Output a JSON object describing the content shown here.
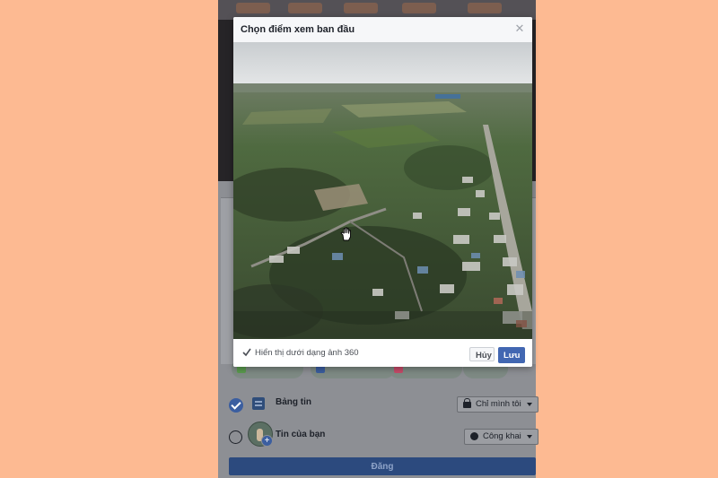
{
  "modal": {
    "title": "Chọn điểm xem ban đầu",
    "close_icon": "close-icon",
    "checkbox_label": "Hiển thị dưới dạng ảnh 360",
    "checkbox_checked": true,
    "cancel_label": "Hủy",
    "save_label": "Lưu"
  },
  "share": {
    "feed_label": "Bảng tin",
    "feed_privacy": "Chỉ mình tôi",
    "story_label": "Tin của bạn",
    "story_privacy": "Công khai",
    "post_label": "Đăng"
  },
  "colors": {
    "background": "#fdba92",
    "primary_button": "#4267b2",
    "post_button": "#2c4a7e"
  }
}
